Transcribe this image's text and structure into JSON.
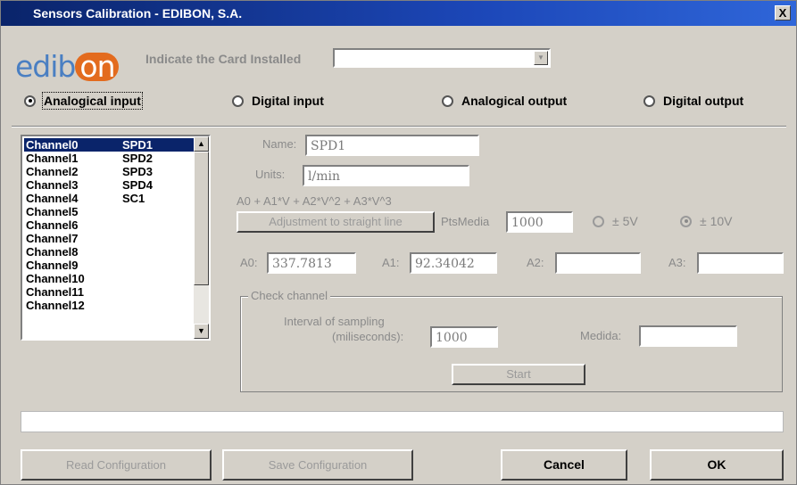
{
  "window": {
    "title": "Sensors Calibration - EDIBON, S.A.",
    "close_label": "X"
  },
  "logo": {
    "part1": "edib",
    "part2": "on"
  },
  "card": {
    "label": "Indicate the Card Installed",
    "value": ""
  },
  "modes": [
    {
      "label": "Analogical input",
      "selected": true
    },
    {
      "label": "Digital input",
      "selected": false
    },
    {
      "label": "Analogical output",
      "selected": false
    },
    {
      "label": "Digital output",
      "selected": false
    }
  ],
  "channels": [
    {
      "name": "Channel0",
      "sensor": "SPD1"
    },
    {
      "name": "Channel1",
      "sensor": "SPD2"
    },
    {
      "name": "Channel2",
      "sensor": "SPD3"
    },
    {
      "name": "Channel3",
      "sensor": "SPD4"
    },
    {
      "name": "Channel4",
      "sensor": "SC1"
    },
    {
      "name": "Channel5",
      "sensor": ""
    },
    {
      "name": "Channel6",
      "sensor": ""
    },
    {
      "name": "Channel7",
      "sensor": ""
    },
    {
      "name": "Channel8",
      "sensor": ""
    },
    {
      "name": "Channel9",
      "sensor": ""
    },
    {
      "name": "Channel10",
      "sensor": ""
    },
    {
      "name": "Channel11",
      "sensor": ""
    },
    {
      "name": "Channel12",
      "sensor": ""
    }
  ],
  "selected_channel": 0,
  "scroll_up_icon": "▲",
  "scroll_down_icon": "▼",
  "combo_arrow_icon": "▼",
  "form": {
    "name_label": "Name:",
    "name_value": "SPD1",
    "units_label": "Units:",
    "units_value": "l/min",
    "formula": "A0 + A1*V + A2*V^2 + A3*V^3",
    "adjust_button": "Adjustment to straight line",
    "ptsmedia_label": "PtsMedia",
    "ptsmedia_value": "1000",
    "range5_label": "± 5V",
    "range10_label": "± 10V",
    "range_selected": "10V",
    "a0_label": "A0:",
    "a0_value": "337.7813",
    "a1_label": "A1:",
    "a1_value": "92.34042",
    "a2_label": "A2:",
    "a2_value": "",
    "a3_label": "A3:",
    "a3_value": ""
  },
  "check": {
    "legend": "Check channel",
    "interval_label_1": "Interval of sampling",
    "interval_label_2": "(miliseconds):",
    "interval_value": "1000",
    "medida_label": "Medida:",
    "medida_value": "",
    "start_button": "Start"
  },
  "status_text": "",
  "buttons": {
    "read": "Read Configuration",
    "save": "Save Configuration",
    "cancel": "Cancel",
    "ok": "OK"
  }
}
